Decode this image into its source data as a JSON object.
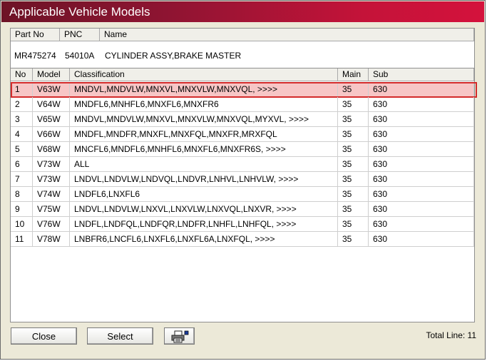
{
  "window": {
    "title": "Applicable Vehicle Models"
  },
  "part": {
    "headers": {
      "part_no": "Part No",
      "pnc": "PNC",
      "name": "Name"
    },
    "values": {
      "part_no": "MR475274",
      "pnc": "54010A",
      "name": "CYLINDER ASSY,BRAKE MASTER"
    }
  },
  "table": {
    "headers": {
      "no": "No",
      "model": "Model",
      "classification": "Classification",
      "main": "Main",
      "sub": "Sub"
    },
    "rows": [
      {
        "no": "1",
        "model": "V63W",
        "classification": "MNDVL,MNDVLW,MNXVL,MNXVLW,MNXVQL,  >>>>",
        "main": "35",
        "sub": "630",
        "selected": true
      },
      {
        "no": "2",
        "model": "V64W",
        "classification": "MNDFL6,MNHFL6,MNXFL6,MNXFR6",
        "main": "35",
        "sub": "630"
      },
      {
        "no": "3",
        "model": "V65W",
        "classification": "MNDVL,MNDVLW,MNXVL,MNXVLW,MNXVQL,MYXVL,  >>>>",
        "main": "35",
        "sub": "630"
      },
      {
        "no": "4",
        "model": "V66W",
        "classification": "MNDFL,MNDFR,MNXFL,MNXFQL,MNXFR,MRXFQL",
        "main": "35",
        "sub": "630"
      },
      {
        "no": "5",
        "model": "V68W",
        "classification": "MNCFL6,MNDFL6,MNHFL6,MNXFL6,MNXFR6S,  >>>>",
        "main": "35",
        "sub": "630"
      },
      {
        "no": "6",
        "model": "V73W",
        "classification": "ALL",
        "main": "35",
        "sub": "630"
      },
      {
        "no": "7",
        "model": "V73W",
        "classification": "LNDVL,LNDVLW,LNDVQL,LNDVR,LNHVL,LNHVLW,  >>>>",
        "main": "35",
        "sub": "630"
      },
      {
        "no": "8",
        "model": "V74W",
        "classification": "LNDFL6,LNXFL6",
        "main": "35",
        "sub": "630"
      },
      {
        "no": "9",
        "model": "V75W",
        "classification": "LNDVL,LNDVLW,LNXVL,LNXVLW,LNXVQL,LNXVR,  >>>>",
        "main": "35",
        "sub": "630"
      },
      {
        "no": "10",
        "model": "V76W",
        "classification": "LNDFL,LNDFQL,LNDFQR,LNDFR,LNHFL,LNHFQL,  >>>>",
        "main": "35",
        "sub": "630"
      },
      {
        "no": "11",
        "model": "V78W",
        "classification": "LNBFR6,LNCFL6,LNXFL6,LNXFL6A,LNXFQL,  >>>>",
        "main": "35",
        "sub": "630"
      }
    ]
  },
  "buttons": {
    "close": "Close",
    "select": "Select",
    "print_icon": "printer-icon"
  },
  "footer": {
    "total_line": "Total Line: 11"
  }
}
